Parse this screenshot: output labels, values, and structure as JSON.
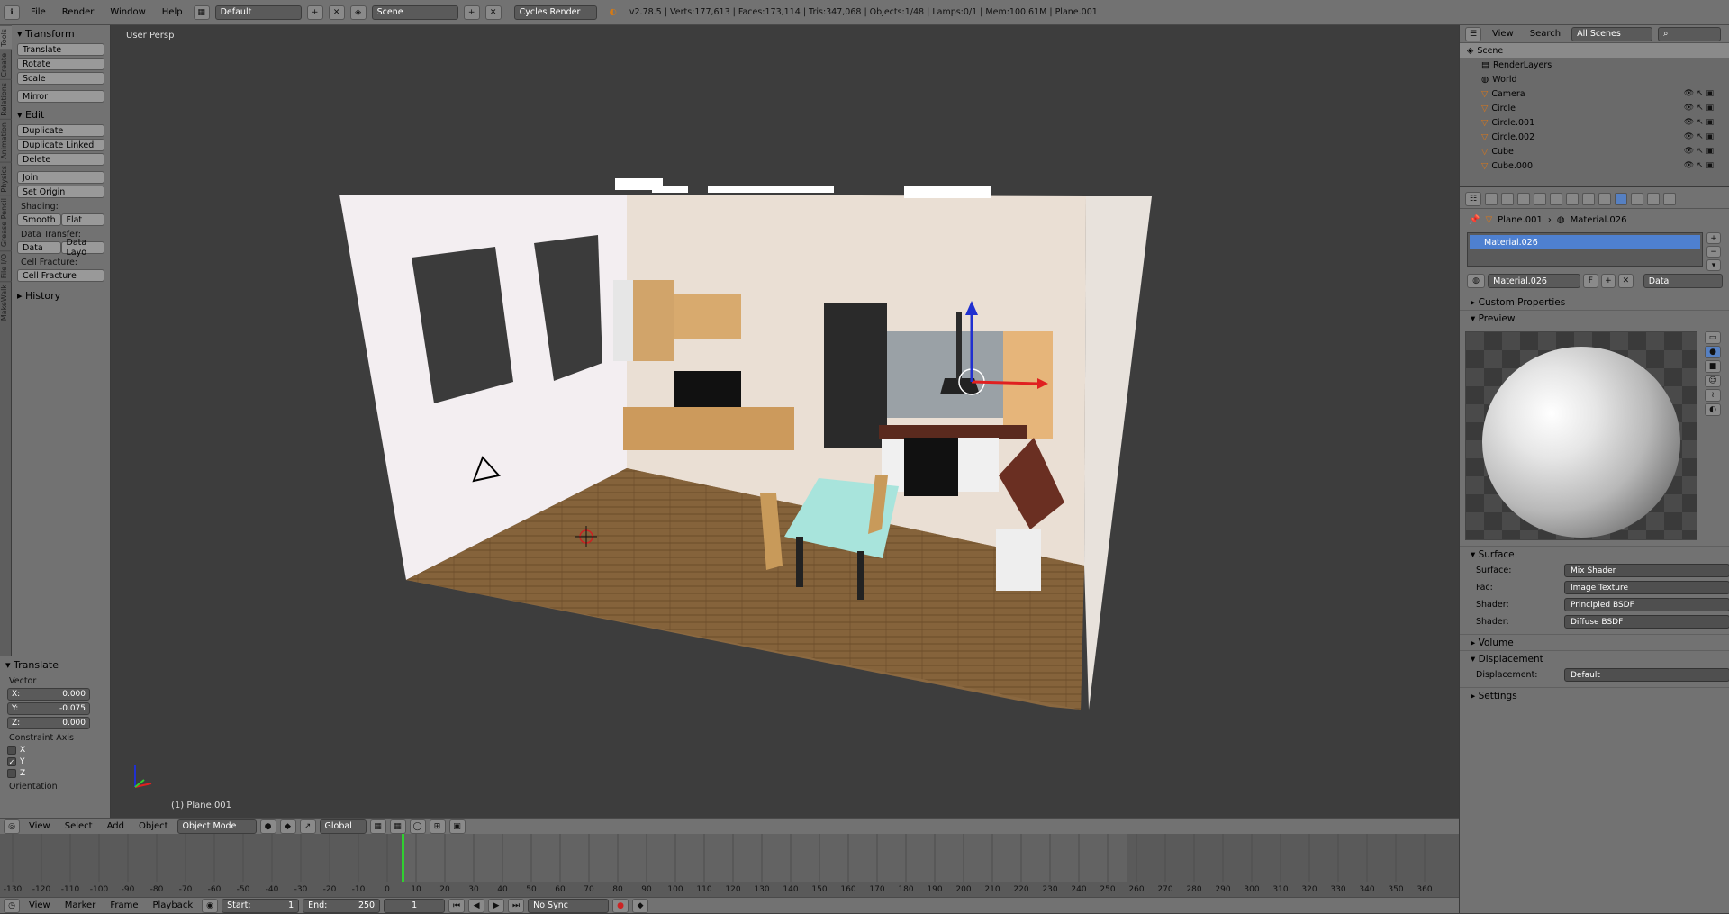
{
  "infobar": {
    "menus": [
      "File",
      "Render",
      "Window",
      "Help"
    ],
    "layout": "Default",
    "scene": "Scene",
    "engine": "Cycles Render",
    "stats": "v2.78.5 | Verts:177,613 | Faces:173,114 | Tris:347,068 | Objects:1/48 | Lamps:0/1 | Mem:100.61M | Plane.001"
  },
  "tool_tabs": [
    "Tools",
    "Create",
    "Relations",
    "Animation",
    "Physics",
    "Grease Pencil",
    "File I/O",
    "MakeWalk"
  ],
  "toolshelf": {
    "transform_header": "Transform",
    "translate": "Translate",
    "rotate": "Rotate",
    "scale": "Scale",
    "mirror": "Mirror",
    "edit_header": "Edit",
    "duplicate": "Duplicate",
    "duplicate_linked": "Duplicate Linked",
    "delete": "Delete",
    "join": "Join",
    "set_origin": "Set Origin",
    "shading_label": "Shading:",
    "smooth": "Smooth",
    "flat": "Flat",
    "data_transfer_label": "Data Transfer:",
    "data": "Data",
    "data_layo": "Data Layo",
    "cell_fracture_label": "Cell Fracture:",
    "cell_fracture": "Cell Fracture",
    "history_header": "History"
  },
  "operator": {
    "header": "Translate",
    "vector_label": "Vector",
    "x_label": "X:",
    "x_value": "0.000",
    "y_label": "Y:",
    "y_value": "-0.075",
    "z_label": "Z:",
    "z_value": "0.000",
    "constraint_label": "Constraint Axis",
    "cx": "X",
    "cy": "Y",
    "cz": "Z",
    "orientation_label": "Orientation"
  },
  "viewport": {
    "view_label": "User Persp",
    "object_label": "(1) Plane.001"
  },
  "view3d_header": {
    "view": "View",
    "select": "Select",
    "add": "Add",
    "object": "Object",
    "mode": "Object Mode",
    "orientation": "Global"
  },
  "timeline": {
    "ticks": [
      "-130",
      "-120",
      "-110",
      "-100",
      "-90",
      "-80",
      "-70",
      "-60",
      "-50",
      "-40",
      "-30",
      "-20",
      "-10",
      "0",
      "10",
      "20",
      "30",
      "40",
      "50",
      "60",
      "70",
      "80",
      "90",
      "100",
      "110",
      "120",
      "130",
      "140",
      "150",
      "160",
      "170",
      "180",
      "190",
      "200",
      "210",
      "220",
      "230",
      "240",
      "250",
      "260",
      "270",
      "280",
      "290",
      "300",
      "310",
      "320",
      "330",
      "340",
      "350",
      "360"
    ],
    "view": "View",
    "marker": "Marker",
    "frame": "Frame",
    "playback": "Playback",
    "start": "Start:",
    "start_value": "1",
    "end": "End:",
    "end_value": "250",
    "current": "1",
    "sync": "No Sync"
  },
  "outliner": {
    "view": "View",
    "search": "Search",
    "filter": "All Scenes",
    "items": [
      {
        "name": "Scene",
        "level": 0
      },
      {
        "name": "RenderLayers",
        "level": 1
      },
      {
        "name": "World",
        "level": 1
      },
      {
        "name": "Camera",
        "level": 1
      },
      {
        "name": "Circle",
        "level": 1
      },
      {
        "name": "Circle.001",
        "level": 1
      },
      {
        "name": "Circle.002",
        "level": 1
      },
      {
        "name": "Cube",
        "level": 1
      },
      {
        "name": "Cube.000",
        "level": 1
      }
    ]
  },
  "properties": {
    "object": "Plane.001",
    "material": "Material.026",
    "slot": "Material.026",
    "mat_field": "Material.026",
    "f_label": "F",
    "link": "Data",
    "custom_props": "Custom Properties",
    "preview": "Preview",
    "surface_header": "Surface",
    "surface_label": "Surface:",
    "surface_value": "Mix Shader",
    "fac_label": "Fac:",
    "fac_value": "Image Texture",
    "shader1_label": "Shader:",
    "shader1_value": "Principled BSDF",
    "shader2_label": "Shader:",
    "shader2_value": "Diffuse BSDF",
    "volume": "Volume",
    "displacement_header": "Displacement",
    "displacement_label": "Displacement:",
    "displacement_value": "Default",
    "settings": "Settings"
  },
  "colors": {
    "accent": "#5680c2",
    "selection": "#4e80d0",
    "x_axis": "#e02020",
    "z_axis": "#2030d0",
    "frame_line": "#30d030"
  }
}
